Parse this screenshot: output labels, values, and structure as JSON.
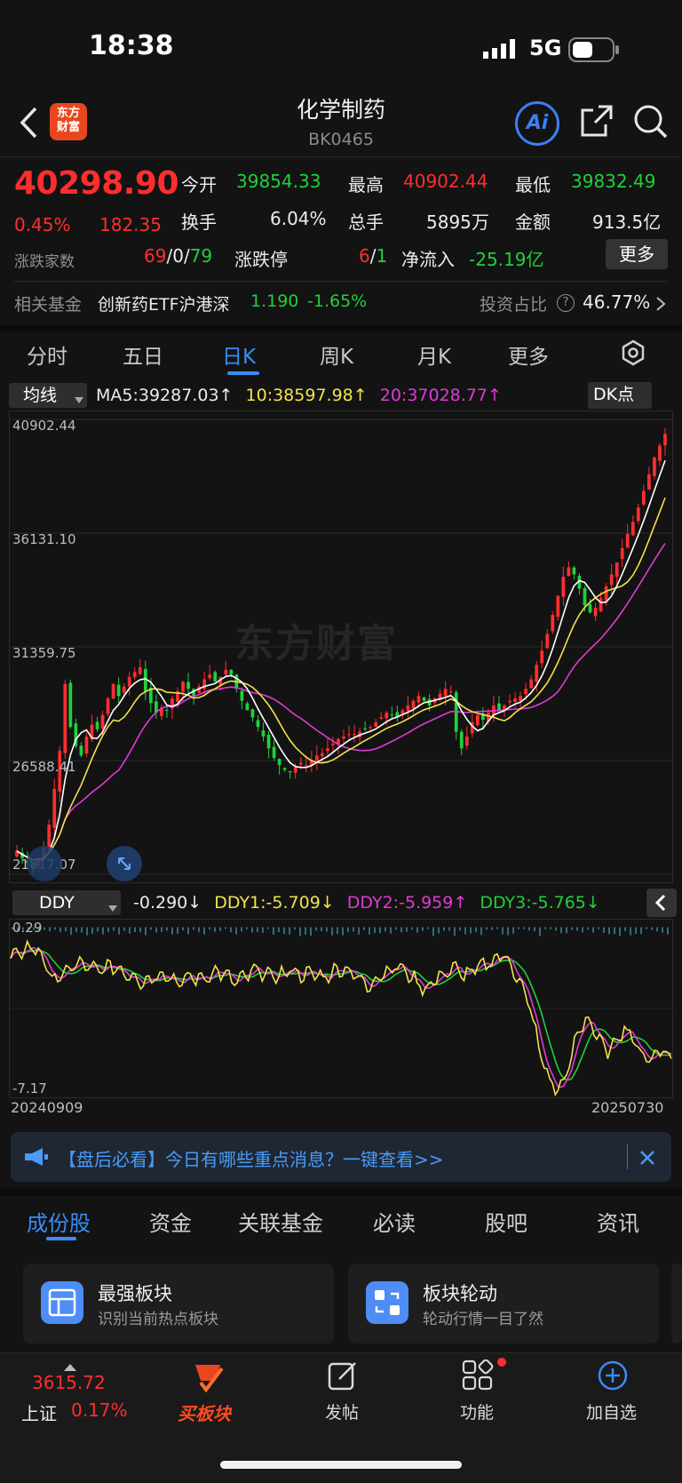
{
  "status_bar": {
    "time": "18:38",
    "network": "5G"
  },
  "header": {
    "title": "化学制药",
    "code": "BK0465",
    "logo_text_1": "东方",
    "logo_text_2": "财富",
    "ai_label": "Ai"
  },
  "quote": {
    "price": "40298.90",
    "change_pct": "0.45%",
    "change": "182.35",
    "open_label": "今开",
    "open": "39854.33",
    "high_label": "最高",
    "high": "40902.44",
    "low_label": "最低",
    "low": "39832.49",
    "turnover_label": "换手",
    "turnover": "6.04%",
    "volume_label": "总手",
    "volume": "5895万",
    "amount_label": "金额",
    "amount": "913.5亿",
    "breadth_label": "涨跌家数",
    "up": "69",
    "flat": "0",
    "down": "79",
    "limit_label": "涨跌停",
    "limit_up": "6",
    "limit_down": "1",
    "netflow_label": "净流入",
    "netflow": "-25.19亿",
    "more": "更多"
  },
  "fund": {
    "label": "相关基金",
    "name": "创新药ETF沪港深",
    "price": "1.190",
    "pct": "-1.65%",
    "ratio_label": "投资占比",
    "ratio": "46.77%"
  },
  "chart_tabs": [
    "分时",
    "五日",
    "日K",
    "周K",
    "月K",
    "更多"
  ],
  "active_chart_tab": "日K",
  "ma_row": {
    "selector": "均线",
    "ma5": "MA5:39287.03",
    "ma10": "10:38597.98",
    "ma20": "20:37028.77",
    "dk": "DK点"
  },
  "ddy_row": {
    "selector": "DDY",
    "ddy": "-0.290",
    "ddy1": "DDY1:-5.709",
    "ddy2": "DDY2:-5.959",
    "ddy3": "DDY3:-5.765"
  },
  "colors": {
    "up": "#ff2e2e",
    "down": "#1fd13a",
    "ma5": "#ffffff",
    "ma10": "#f2e34a",
    "ma20": "#e03ad9",
    "accent": "#3a8df6"
  },
  "chart_data": {
    "type": "candlestick",
    "y_ticks": [
      "40902.44",
      "36131.10",
      "31359.75",
      "26588.41",
      "21817.07"
    ],
    "ylim": [
      21817.07,
      40902.44
    ],
    "x_start": "20240909",
    "x_end": "20250730",
    "sub_ticks": [
      "0.29",
      "-7.17"
    ],
    "sub_ylim": [
      -7.17,
      0.29
    ],
    "close_path": [
      22800,
      22500,
      22300,
      22100,
      22500,
      22900,
      23900,
      25400,
      27000,
      29800,
      28000,
      27200,
      26800,
      27600,
      28100,
      27900,
      28500,
      29200,
      29800,
      29300,
      29700,
      30100,
      30300,
      30500,
      29500,
      29000,
      28600,
      28800,
      28700,
      29200,
      29500,
      29900,
      29600,
      29300,
      29700,
      30000,
      30200,
      29900,
      30100,
      30400,
      30200,
      29600,
      29100,
      28700,
      28400,
      28000,
      27600,
      27100,
      26700,
      26400,
      26200,
      26100,
      26300,
      26500,
      26400,
      26600,
      26800,
      26900,
      27100,
      27300,
      27500,
      27600,
      27700,
      27700,
      27800,
      27900,
      28000,
      28200,
      28400,
      28600,
      28500,
      28400,
      28700,
      28900,
      29100,
      29300,
      29100,
      28900,
      29200,
      29400,
      29600,
      29500,
      27800,
      27100,
      27600,
      28200,
      28500,
      28300,
      28600,
      28900,
      28700,
      28900,
      29100,
      29200,
      29300,
      29600,
      30000,
      30600,
      31200,
      31900,
      32700,
      33500,
      34300,
      34700,
      34400,
      33800,
      33100,
      32800,
      33000,
      33400,
      33900,
      34400,
      34900,
      35500,
      36100,
      36600,
      37200,
      37900,
      38600,
      39300,
      39800,
      40298.9
    ],
    "ddy_path": [
      -1.3,
      -1.0,
      -0.8,
      -0.9,
      -1.9,
      -2.2,
      -1.8,
      -1.5,
      -1.6,
      -1.8,
      -1.7,
      -1.6,
      -1.9,
      -2.0,
      -2.3,
      -2.1,
      -1.9,
      -2.1,
      -2.4,
      -2.0,
      -2.2,
      -2.0,
      -1.8,
      -2.1,
      -2.3,
      -2.0,
      -1.8,
      -1.9,
      -2.1,
      -1.9,
      -1.8,
      -2.0,
      -1.9,
      -2.1,
      -1.9,
      -1.7,
      -1.8,
      -2.2,
      -2.5,
      -2.0,
      -1.8,
      -1.6,
      -1.9,
      -2.3,
      -2.6,
      -2.2,
      -1.9,
      -1.7,
      -2.0,
      -1.8,
      -1.6,
      -1.4,
      -1.1,
      -1.5,
      -2.4,
      -3.3,
      -5.2,
      -6.5,
      -7.0,
      -6.2,
      -4.6,
      -3.8,
      -4.5,
      -5.3,
      -5.0,
      -4.2,
      -4.8,
      -5.5,
      -5.6,
      -5.1,
      -5.7
    ]
  },
  "banner": {
    "text": "【盘后必看】今日有哪些重点消息？一键查看>>"
  },
  "bottom_tabs": [
    "成份股",
    "资金",
    "关联基金",
    "必读",
    "股吧",
    "资讯"
  ],
  "cards": [
    {
      "title": "最强板块",
      "subtitle": "识别当前热点板块"
    },
    {
      "title": "板块轮动",
      "subtitle": "轮动行情一目了然"
    }
  ],
  "nav": {
    "index_value": "3615.72",
    "index_name": "上证",
    "index_pct": "0.17%",
    "buy_label": "买板块",
    "post_label": "发帖",
    "func_label": "功能",
    "add_label": "加自选"
  }
}
